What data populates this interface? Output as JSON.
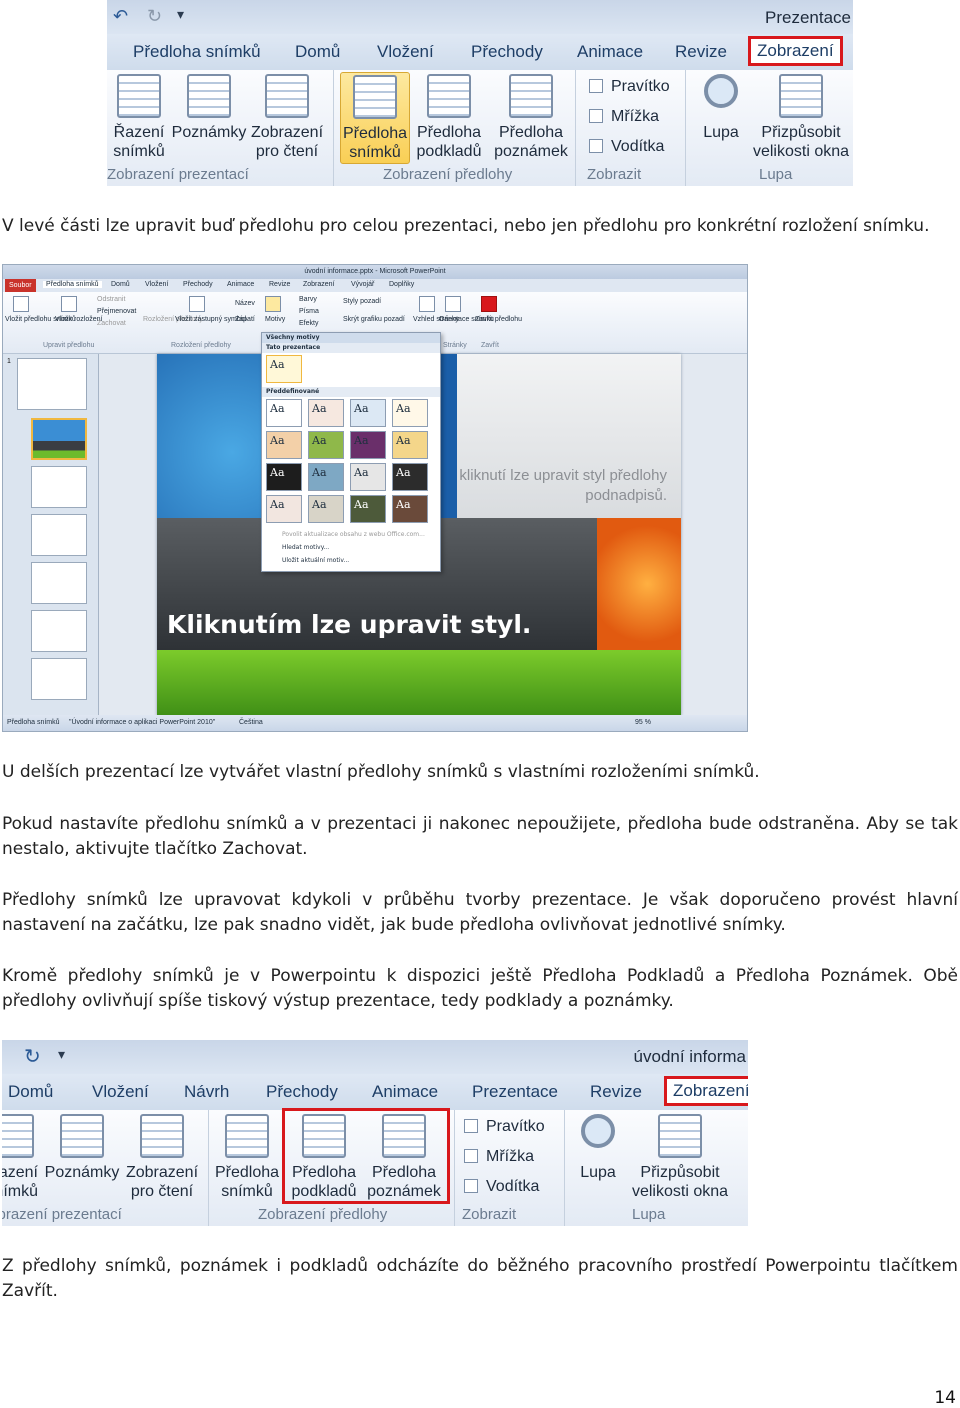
{
  "ribbon1": {
    "title": "Prezentace",
    "tabs": [
      "Předloha snímků",
      "Domů",
      "Vložení",
      "Přechody",
      "Animace",
      "Revize",
      "Zobrazení"
    ],
    "groups": {
      "presentation_views": {
        "label": "Zobrazení prezentací",
        "buttons": [
          [
            "Řazení",
            "snímků"
          ],
          [
            "Poznámky",
            ""
          ],
          [
            "Zobrazení",
            "pro čtení"
          ]
        ]
      },
      "master_views": {
        "label": "Zobrazení předlohy",
        "buttons": [
          [
            "Předloha",
            "snímků"
          ],
          [
            "Předloha",
            "podkladů"
          ],
          [
            "Předloha",
            "poznámek"
          ]
        ]
      },
      "show": {
        "label": "Zobrazit",
        "items": [
          "Pravítko",
          "Mřížka",
          "Vodítka"
        ]
      },
      "zoom": {
        "label": "Lupa",
        "buttons": [
          [
            "Lupa",
            ""
          ],
          [
            "Přizpůsobit",
            "velikosti okna"
          ]
        ]
      }
    }
  },
  "paragraphs": {
    "p1": "V levé části lze upravit buď předlohu pro celou prezentaci, nebo jen předlohu pro konkrétní rozložení snímku.",
    "p2": "U delších prezentací lze vytvářet vlastní předlohy snímků s vlastními rozloženími snímků.",
    "p3": "Pokud nastavíte předlohu snímků a v prezentaci ji nakonec nepoužijete, předloha bude odstraněna. Aby se tak nestalo, aktivujte tlačítko Zachovat.",
    "p4": "Předlohy snímků lze upravovat kdykoli v průběhu tvorby prezentace. Je však doporučeno provést hlavní nastavení na začátku, lze pak snadno vidět, jak bude předloha ovlivňovat jednotlivé snímky.",
    "p5": "Kromě předlohy snímků je v Powerpointu k dispozici ještě Předloha Podkladů a Předloha Poznámek. Obě předlohy ovlivňují spíše tiskový výstup prezentace, tedy podklady a poznámky.",
    "p6": "Z předlohy snímků, poznámek i podkladů odcházíte do běžného pracovního prostředí Powerpointu tlačítkem Zavřít."
  },
  "pp_window": {
    "title": "úvodní informace.pptx - Microsoft PowerPoint",
    "tabs": [
      "Soubor",
      "Předloha snímků",
      "Domů",
      "Vložení",
      "Přechody",
      "Animace",
      "Revize",
      "Zobrazení",
      "Vývojář",
      "Doplňky"
    ],
    "ribbon_items": [
      "Vložit předlohu snímků",
      "Vložit rozložení",
      "Odstranit",
      "Přejmenovat",
      "Zachovat",
      "Rozložení předlohy",
      "Vložit zástupný symbol",
      "Název",
      "Zápatí",
      "Motivy",
      "Barvy",
      "Písma",
      "Efekty",
      "Styly pozadí",
      "Skrýt grafiku pozadí",
      "Vzhled stránky",
      "Orientace snímku",
      "Zavřít předlohu"
    ],
    "group_labels": [
      "Upravit předlohu",
      "Rozložení předlohy",
      "Stránky",
      "Zavřít"
    ],
    "theme_dropdown": {
      "filter": "Všechny motivy",
      "this_presentation": "Tato prezentace",
      "builtin": "Předdefinované",
      "swatch": "Aa",
      "menu": [
        "Povolit aktualizace obsahu z webu Office.com...",
        "Hledat motivy...",
        "Uložit aktuální motiv..."
      ]
    },
    "slide": {
      "title": "Kliknutím lze upravit styl.",
      "subtitle": "kliknutí lze upravit styl předlohy podnadpisů."
    },
    "status": [
      "Předloha snímků",
      "\"Úvodní informace o aplikaci PowerPoint 2010\"",
      "Čeština",
      "95 %"
    ],
    "thumb_number": "1"
  },
  "ribbon2": {
    "title": "úvodní informa",
    "tabs": [
      "Domů",
      "Vložení",
      "Návrh",
      "Přechody",
      "Animace",
      "Prezentace",
      "Revize",
      "Zobrazení"
    ],
    "groups": {
      "presentation_views": {
        "label": "Zobrazení prezentací",
        "buttons": [
          [
            "Řazení",
            "snímků"
          ],
          [
            "Poznámky",
            ""
          ],
          [
            "Zobrazení",
            "pro čtení"
          ]
        ]
      },
      "master_views": {
        "label": "Zobrazení předlohy",
        "buttons": [
          [
            "Předloha",
            "snímků"
          ],
          [
            "Předloha",
            "podkladů"
          ],
          [
            "Předloha",
            "poznámek"
          ]
        ]
      },
      "show": {
        "label": "Zobrazit",
        "items": [
          "Pravítko",
          "Mřížka",
          "Vodítka"
        ]
      },
      "zoom": {
        "label": "Lupa",
        "buttons": [
          [
            "Lupa",
            ""
          ],
          [
            "Přizpůsobit",
            "velikosti okna"
          ]
        ]
      }
    }
  },
  "page_number": "14",
  "colors": {
    "highlight_red": "#d8181c",
    "ribbon_blue": "#1e3e66"
  }
}
